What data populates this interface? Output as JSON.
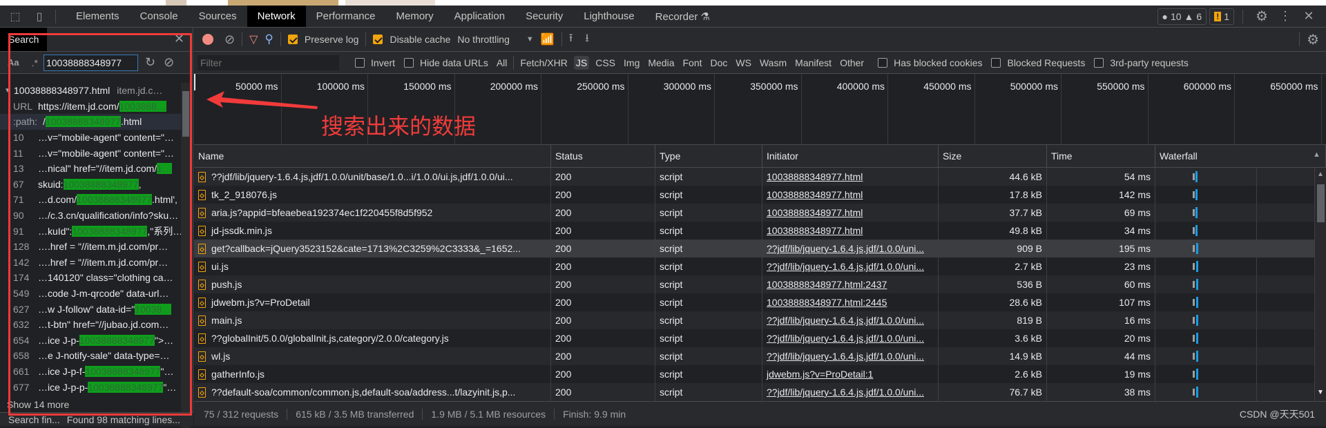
{
  "colors": {
    "accent": "#f2a40d",
    "match_highlight": "#0e9e1c",
    "annotation": "#f13b3b",
    "active_tab": "#000000",
    "waterfall": "#1a9ce6"
  },
  "tabs": [
    "Elements",
    "Console",
    "Sources",
    "Network",
    "Performance",
    "Memory",
    "Application",
    "Security",
    "Lighthouse",
    "Recorder ⚗"
  ],
  "active_tab": "Network",
  "badges": {
    "errors": "10",
    "warnings": "6",
    "issues": "1"
  },
  "search": {
    "title": "Search",
    "case_label": "Aa",
    "regex_label": ".*",
    "query": "10038888348977",
    "file": {
      "name": "10038888348977.html",
      "host": "item.jd.c…"
    },
    "results": [
      {
        "num": "URL",
        "pre": "https://item.jd.com/",
        "match": "1003888…",
        "post": ""
      },
      {
        "num": ":path:",
        "pre": "/",
        "match": "10038888348977",
        "post": ".html"
      },
      {
        "num": "10",
        "pre": "…v=\"mobile-agent\" content=\"…",
        "match": "",
        "post": ""
      },
      {
        "num": "11",
        "pre": "…v=\"mobile-agent\" content=\"…",
        "match": "",
        "post": ""
      },
      {
        "num": "13",
        "pre": "…nical\" href=\"//item.jd.com/",
        "match": "1…",
        "post": ""
      },
      {
        "num": "67",
        "pre": "skuid: ",
        "match": "10038888348977",
        "post": ","
      },
      {
        "num": "71",
        "pre": "…d.com/",
        "match": "10038888348977",
        "post": ".html',"
      },
      {
        "num": "90",
        "pre": "…/c.3.cn/qualification/info?sku…",
        "match": "",
        "post": ""
      },
      {
        "num": "91",
        "pre": "…kuId\":",
        "match": "10038888348977",
        "post": ",\"系列…"
      },
      {
        "num": "128",
        "pre": "….href = \"//item.m.jd.com/pr…",
        "match": "",
        "post": ""
      },
      {
        "num": "142",
        "pre": "….href = \"//item.m.jd.com/pr…",
        "match": "",
        "post": ""
      },
      {
        "num": "174",
        "pre": "…140120\" class=\"clothing ca…",
        "match": "",
        "post": ""
      },
      {
        "num": "549",
        "pre": "…code J-m-qrcode\" data-url…",
        "match": "",
        "post": ""
      },
      {
        "num": "627",
        "pre": "…w J-follow\" data-id=\"",
        "match": "10038…",
        "post": ""
      },
      {
        "num": "632",
        "pre": "…t-btn\" href=\"//jubao.jd.com…",
        "match": "",
        "post": ""
      },
      {
        "num": "654",
        "pre": "…ice J-p-",
        "match": "10038888348977",
        "post": "\">…"
      },
      {
        "num": "658",
        "pre": "…e J-notify-sale\" data-type=…",
        "match": "",
        "post": ""
      },
      {
        "num": "661",
        "pre": "…ice J-p-f-",
        "match": "10038888348977",
        "post": "\"…"
      },
      {
        "num": "677",
        "pre": "…ice J-p-p-",
        "match": "10038888348977",
        "post": "\"…"
      }
    ],
    "show_more": "Show 14 more",
    "status_left": "Search fin...",
    "status_right": "Found 98 matching lines..."
  },
  "toolbar": {
    "preserve_log": "Preserve log",
    "preserve_log_checked": true,
    "disable_cache": "Disable cache",
    "disable_cache_checked": true,
    "throttling": "No throttling"
  },
  "filter": {
    "placeholder": "Filter",
    "invert": "Invert",
    "hide_data_urls": "Hide data URLs",
    "types": [
      "All",
      "Fetch/XHR",
      "JS",
      "CSS",
      "Img",
      "Media",
      "Font",
      "Doc",
      "WS",
      "Wasm",
      "Manifest",
      "Other"
    ],
    "active_type": "JS",
    "has_blocked_cookies": "Has blocked cookies",
    "blocked_requests": "Blocked Requests",
    "third_party": "3rd-party requests"
  },
  "timeline_ticks": [
    "50000 ms",
    "100000 ms",
    "150000 ms",
    "200000 ms",
    "250000 ms",
    "300000 ms",
    "350000 ms",
    "400000 ms",
    "450000 ms",
    "500000 ms",
    "550000 ms",
    "600000 ms",
    "650000 ms"
  ],
  "annotation": "搜索出来的数据",
  "table": {
    "columns": [
      "Name",
      "Status",
      "Type",
      "Initiator",
      "Size",
      "Time",
      "Waterfall"
    ],
    "selected_row": 4,
    "rows": [
      {
        "name": "??jdf/lib/jquery-1.6.4.js,jdf/1.0.0/unit/base/1.0...i/1.0.0/ui.js,jdf/1.0.0/ui...",
        "status": "200",
        "type": "script",
        "initiator": "10038888348977.html",
        "size": "44.6 kB",
        "time": "54 ms"
      },
      {
        "name": "tk_2_918076.js",
        "status": "200",
        "type": "script",
        "initiator": "10038888348977.html",
        "size": "17.8 kB",
        "time": "142 ms"
      },
      {
        "name": "aria.js?appid=bfeaebea192374ec1f220455f8d5f952",
        "status": "200",
        "type": "script",
        "initiator": "10038888348977.html",
        "size": "37.7 kB",
        "time": "69 ms"
      },
      {
        "name": "jd-jssdk.min.js",
        "status": "200",
        "type": "script",
        "initiator": "10038888348977.html",
        "size": "49.8 kB",
        "time": "34 ms"
      },
      {
        "name": "get?callback=jQuery3523152&cate=1713%2C3259%2C3333&_=1652...",
        "status": "200",
        "type": "script",
        "initiator": "??jdf/lib/jquery-1.6.4.js,jdf/1.0.0/uni...",
        "size": "909 B",
        "time": "195 ms"
      },
      {
        "name": "ui.js",
        "status": "200",
        "type": "script",
        "initiator": "??jdf/lib/jquery-1.6.4.js,jdf/1.0.0/uni...",
        "size": "2.7 kB",
        "time": "23 ms"
      },
      {
        "name": "push.js",
        "status": "200",
        "type": "script",
        "initiator": "10038888348977.html:2437",
        "size": "536 B",
        "time": "60 ms"
      },
      {
        "name": "jdwebm.js?v=ProDetail",
        "status": "200",
        "type": "script",
        "initiator": "10038888348977.html:2445",
        "size": "28.6 kB",
        "time": "107 ms"
      },
      {
        "name": "main.js",
        "status": "200",
        "type": "script",
        "initiator": "??jdf/lib/jquery-1.6.4.js,jdf/1.0.0/uni...",
        "size": "819 B",
        "time": "16 ms"
      },
      {
        "name": "??globalInit/5.0.0/globalInit.js,category/2.0.0/category.js",
        "status": "200",
        "type": "script",
        "initiator": "??jdf/lib/jquery-1.6.4.js,jdf/1.0.0/uni...",
        "size": "3.6 kB",
        "time": "20 ms"
      },
      {
        "name": "wl.js",
        "status": "200",
        "type": "script",
        "initiator": "??jdf/lib/jquery-1.6.4.js,jdf/1.0.0/uni...",
        "size": "14.9 kB",
        "time": "44 ms"
      },
      {
        "name": "gatherInfo.js",
        "status": "200",
        "type": "script",
        "initiator": "jdwebm.js?v=ProDetail:1",
        "size": "2.6 kB",
        "time": "19 ms"
      },
      {
        "name": "??default-soa/common/common.js,default-soa/address...t/lazyinit.js,p...",
        "status": "200",
        "type": "script",
        "initiator": "??jdf/lib/jquery-1.6.4.js,jdf/1.0.0/uni...",
        "size": "76.7 kB",
        "time": "38 ms"
      }
    ]
  },
  "statusbar": [
    "75 / 312 requests",
    "615 kB / 3.5 MB transferred",
    "1.9 MB / 5.1 MB resources",
    "Finish: 9.9 min"
  ],
  "watermark": "CSDN @天天501"
}
